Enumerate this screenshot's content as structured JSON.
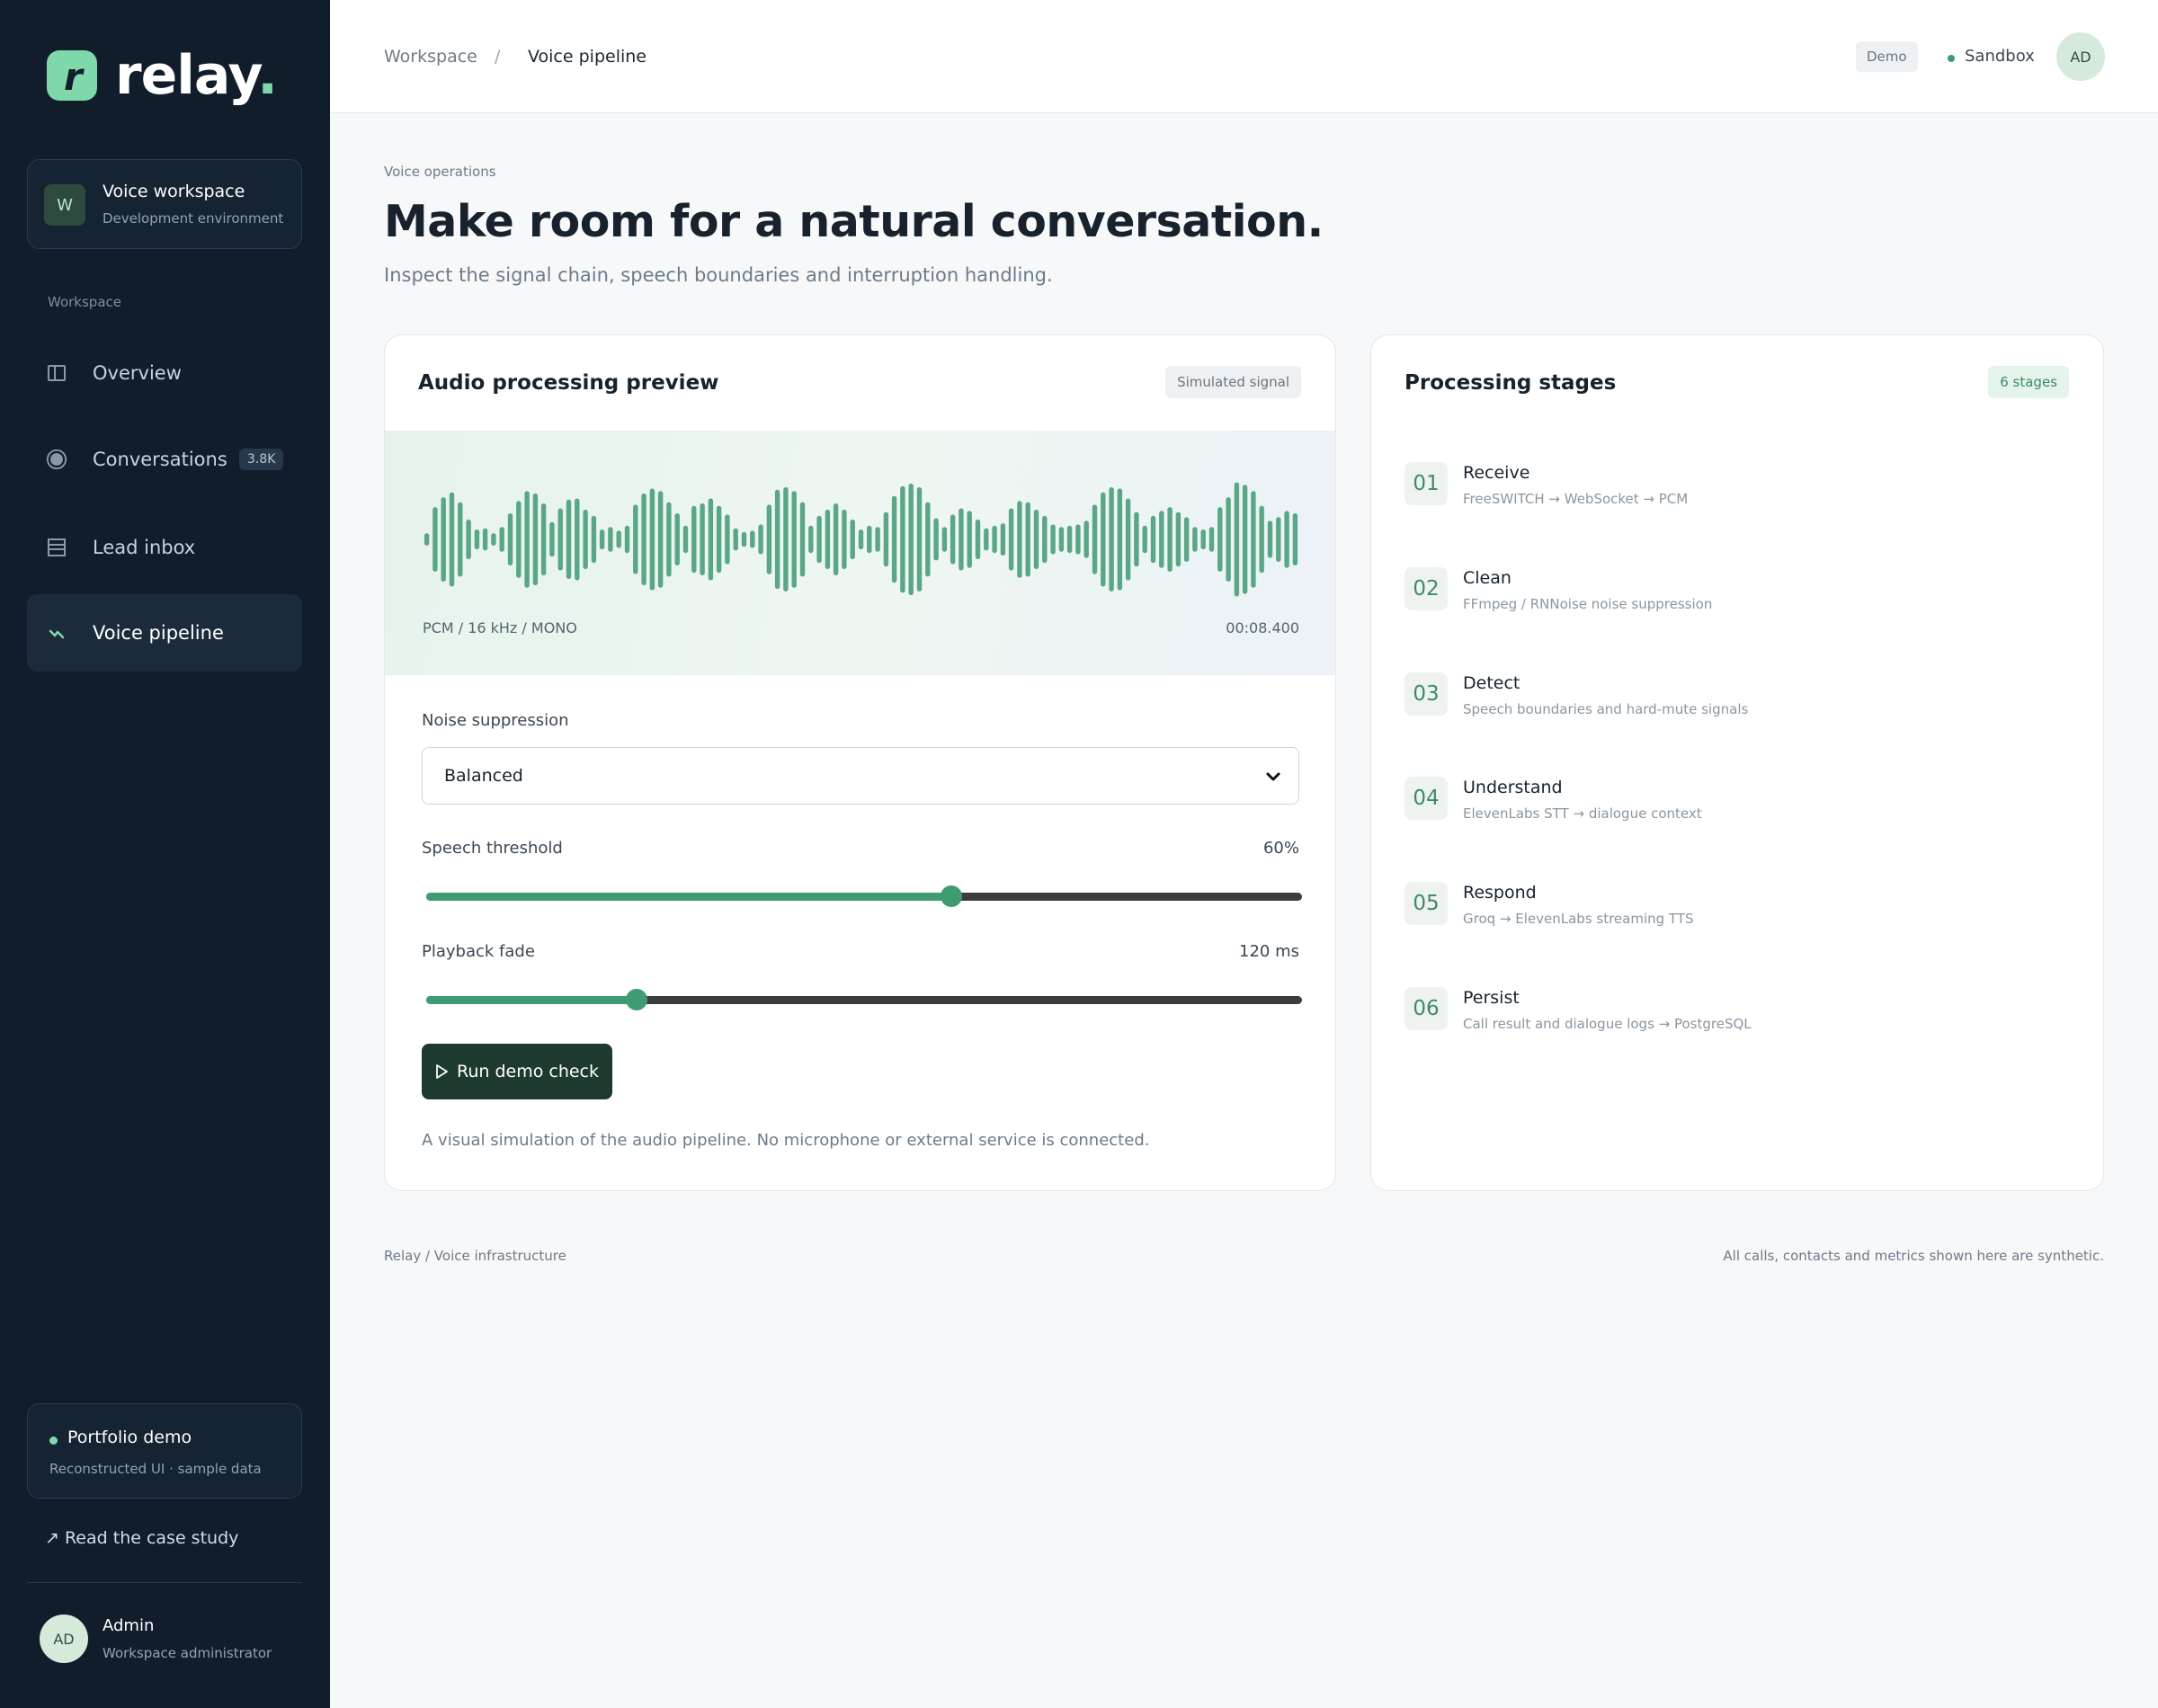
{
  "brand": {
    "name": "relay",
    "dot": ".",
    "accent": "#7fd8ac",
    "logo_glyph": "r"
  },
  "workspace_card": {
    "avatar": "W",
    "title": "Voice workspace",
    "subtitle": "Development environment"
  },
  "sidebar": {
    "section_label": "Workspace",
    "items": [
      {
        "label": "Overview",
        "icon": "columns-icon",
        "active": false
      },
      {
        "label": "Conversations",
        "icon": "circle-icon",
        "badge": "3.8K",
        "active": false
      },
      {
        "label": "Lead inbox",
        "icon": "list-icon",
        "active": false
      },
      {
        "label": "Voice pipeline",
        "icon": "wave-icon",
        "active": true
      }
    ],
    "demo_card": {
      "title": "Portfolio demo",
      "subtitle": "Reconstructed UI · sample data"
    },
    "case_study_link": "↗ Read the case study",
    "user": {
      "avatar": "AD",
      "name": "Admin",
      "role": "Workspace administrator"
    }
  },
  "topbar": {
    "breadcrumb": [
      "Workspace",
      "/",
      "Voice pipeline"
    ],
    "demo_chip": "Demo",
    "environment": "Sandbox",
    "avatar": "AD"
  },
  "main": {
    "eyebrow": "Voice operations",
    "title": "Make room for a natural conversation.",
    "subtitle": "Inspect the signal chain, speech boundaries and interruption handling."
  },
  "audio_card": {
    "title": "Audio processing preview",
    "chip": "Simulated signal",
    "waveform": {
      "format": "PCM / 16 kHz / MONO",
      "time": "00:08.400",
      "color": "#5aa785",
      "bars": [
        0.1,
        0.52,
        0.68,
        0.76,
        0.6,
        0.32,
        0.16,
        0.18,
        0.1,
        0.2,
        0.42,
        0.62,
        0.78,
        0.74,
        0.58,
        0.28,
        0.5,
        0.64,
        0.66,
        0.48,
        0.38,
        0.16,
        0.2,
        0.14,
        0.22,
        0.56,
        0.74,
        0.82,
        0.78,
        0.6,
        0.42,
        0.22,
        0.54,
        0.58,
        0.66,
        0.54,
        0.4,
        0.18,
        0.12,
        0.14,
        0.24,
        0.56,
        0.8,
        0.84,
        0.78,
        0.6,
        0.22,
        0.38,
        0.48,
        0.58,
        0.48,
        0.32,
        0.16,
        0.22,
        0.2,
        0.44,
        0.7,
        0.86,
        0.9,
        0.84,
        0.6,
        0.34,
        0.2,
        0.4,
        0.5,
        0.46,
        0.32,
        0.18,
        0.22,
        0.26,
        0.5,
        0.62,
        0.6,
        0.48,
        0.38,
        0.24,
        0.2,
        0.22,
        0.24,
        0.3,
        0.56,
        0.76,
        0.84,
        0.82,
        0.66,
        0.44,
        0.22,
        0.38,
        0.46,
        0.52,
        0.44,
        0.36,
        0.2,
        0.16,
        0.2,
        0.52,
        0.68,
        0.92,
        0.88,
        0.78,
        0.54,
        0.3,
        0.36,
        0.46,
        0.42
      ]
    },
    "noise_label": "Noise suppression",
    "noise_value": "Balanced",
    "threshold_label": "Speech threshold",
    "threshold_value": "60%",
    "threshold_fraction": 0.6,
    "fade_label": "Playback fade",
    "fade_value": "120 ms",
    "fade_fraction": 0.24,
    "run_button": "Run demo check",
    "disclaimer": "A visual simulation of the audio pipeline. No microphone or external service is connected."
  },
  "stages_card": {
    "title": "Processing stages",
    "chip": "6 stages",
    "stages": [
      {
        "num": "01",
        "name": "Receive",
        "desc": "FreeSWITCH → WebSocket → PCM"
      },
      {
        "num": "02",
        "name": "Clean",
        "desc": "FFmpeg / RNNoise noise suppression"
      },
      {
        "num": "03",
        "name": "Detect",
        "desc": "Speech boundaries and hard-mute signals"
      },
      {
        "num": "04",
        "name": "Understand",
        "desc": "ElevenLabs STT → dialogue context"
      },
      {
        "num": "05",
        "name": "Respond",
        "desc": "Groq → ElevenLabs streaming TTS"
      },
      {
        "num": "06",
        "name": "Persist",
        "desc": "Call result and dialogue logs → PostgreSQL"
      }
    ]
  },
  "footer": {
    "left": "Relay / Voice infrastructure",
    "right": "All calls, contacts and metrics shown here are synthetic."
  }
}
